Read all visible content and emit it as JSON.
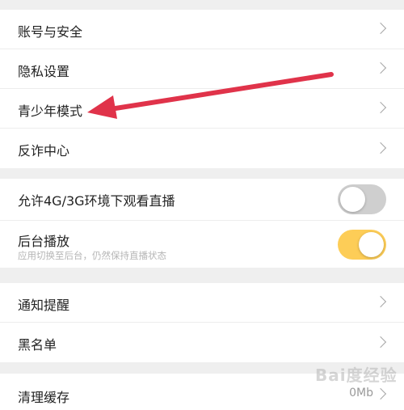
{
  "account_group": {
    "items": [
      {
        "label": "账号与安全"
      },
      {
        "label": "隐私设置"
      },
      {
        "label": "青少年模式"
      },
      {
        "label": "反诈中心"
      }
    ]
  },
  "playback_group": {
    "mobile_data": {
      "label": "允许4G/3G环境下观看直播",
      "enabled": false
    },
    "background_play": {
      "label": "后台播放",
      "sub": "应用切换至后台，仍然保持直播状态",
      "enabled": true
    }
  },
  "notify_group": {
    "items": [
      {
        "label": "通知提醒"
      },
      {
        "label": "黑名单"
      }
    ]
  },
  "cache_group": {
    "label": "清理缓存",
    "value": "0Mb"
  },
  "colors": {
    "toggle_on": "#fdcd57",
    "toggle_off": "#cfcfcf",
    "arrow": "#e0334a"
  },
  "watermark": "Bai度经验"
}
